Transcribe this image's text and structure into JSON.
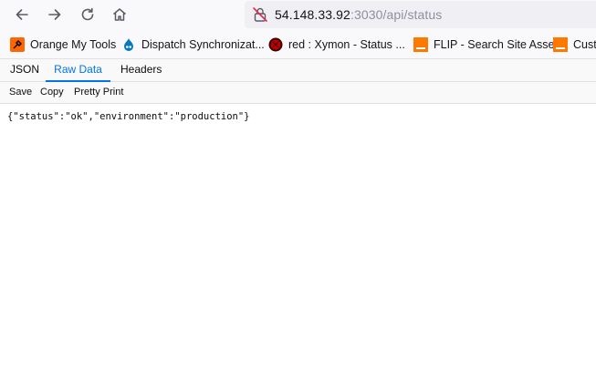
{
  "browser": {
    "url_host": "54.148.33.92",
    "url_path": ":3030/api/status"
  },
  "bookmarks": [
    {
      "label": "Orange My Tools",
      "icon": "orange-tools-icon",
      "color": "#ff6600"
    },
    {
      "label": "Dispatch Synchronizat...",
      "icon": "drupal-icon",
      "color": "#0678be"
    },
    {
      "label": "red : Xymon - Status ...",
      "icon": "xymon-icon",
      "color": "#c00000"
    },
    {
      "label": "FLIP - Search Site Asset",
      "icon": "orange-square-icon",
      "color": "#ff7900"
    },
    {
      "label": "Custo",
      "icon": "orange-square-icon",
      "color": "#ff7900"
    }
  ],
  "viewer": {
    "tabs": [
      "JSON",
      "Raw Data",
      "Headers"
    ],
    "active_tab": "Raw Data",
    "toolbar": {
      "save": "Save",
      "copy": "Copy",
      "pretty_print": "Pretty Print"
    },
    "raw_text": "{\"status\":\"ok\",\"environment\":\"production\"}"
  },
  "colors": {
    "accent": "#0074e8"
  }
}
